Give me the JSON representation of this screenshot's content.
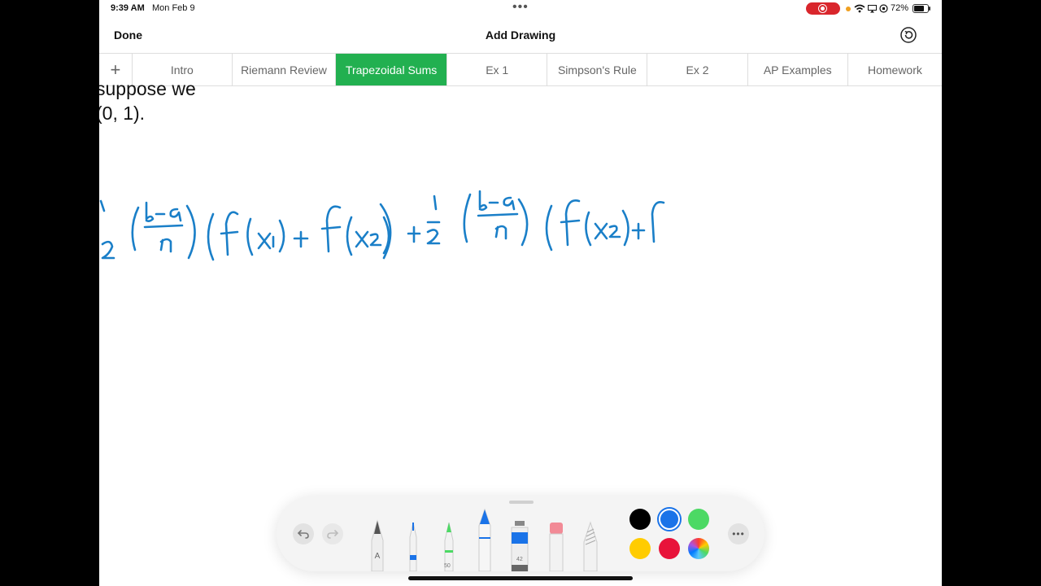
{
  "status_bar": {
    "time": "9:39 AM",
    "date": "Mon Feb 9",
    "battery": "72%"
  },
  "nav": {
    "done_label": "Done",
    "title": "Add Drawing"
  },
  "tabs": [
    {
      "label": "Intro"
    },
    {
      "label": "Riemann Review"
    },
    {
      "label": "Trapezoidal Sums",
      "active": true
    },
    {
      "label": "Ex 1"
    },
    {
      "label": "Simpson's Rule"
    },
    {
      "label": "Ex 2"
    },
    {
      "label": "AP Examples"
    },
    {
      "label": "Homework"
    }
  ],
  "canvas": {
    "text_line_1": "suppose we",
    "text_line_2": "(0, 1).",
    "ink_color": "#1a7fc8"
  },
  "toolbar": {
    "marker_width_label": "50",
    "watercolor_label": "42",
    "colors": [
      "#000000",
      "#1a73e8",
      "#4cd964",
      "#ffcc00",
      "#e8133a",
      "rainbow"
    ],
    "selected_color_index": 1
  },
  "icons": {
    "add": "plus-icon",
    "history": "history-icon",
    "undo": "undo-icon",
    "redo": "redo-icon",
    "more": "more-icon"
  }
}
